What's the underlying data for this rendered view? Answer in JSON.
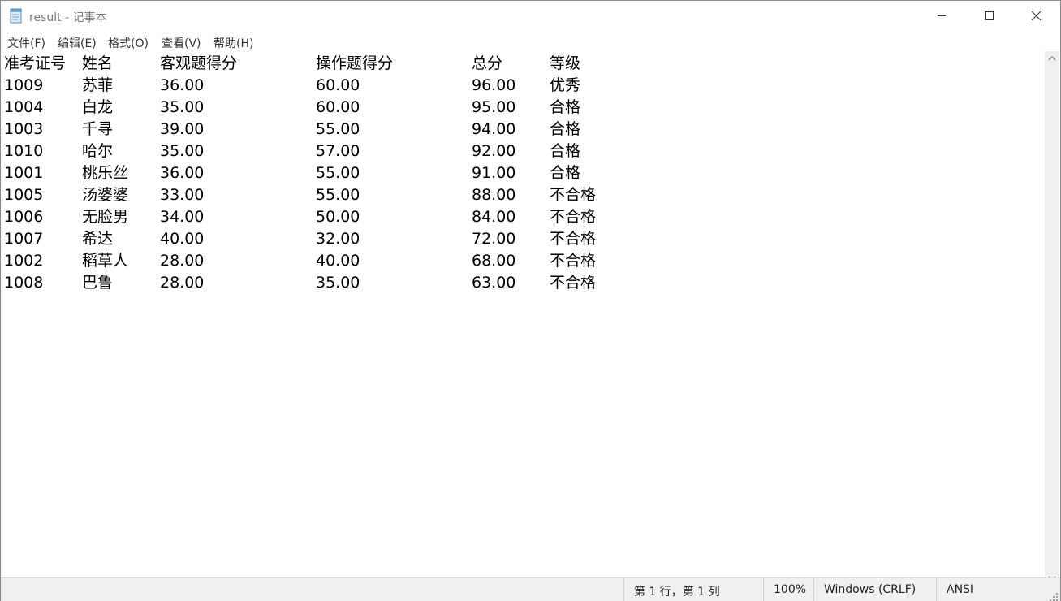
{
  "window": {
    "title": "result - 记事本",
    "icon": "notepad-icon",
    "controls": {
      "minimize_icon": "minimize-icon",
      "maximize_icon": "maximize-icon",
      "close_icon": "close-icon"
    }
  },
  "menu": [
    {
      "label": "文件(F)"
    },
    {
      "label": "编辑(E)"
    },
    {
      "label": "格式(O)"
    },
    {
      "label": "查看(V)"
    },
    {
      "label": "帮助(H)"
    }
  ],
  "document": {
    "header": [
      "准考证号",
      "姓名",
      "客观题得分",
      "操作题得分",
      "总分",
      "等级"
    ],
    "rows": [
      [
        "1009",
        "苏菲",
        "36.00",
        "60.00",
        "96.00",
        "优秀"
      ],
      [
        "1004",
        "白龙",
        "35.00",
        "60.00",
        "95.00",
        "合格"
      ],
      [
        "1003",
        "千寻",
        "39.00",
        "55.00",
        "94.00",
        "合格"
      ],
      [
        "1010",
        "哈尔",
        "35.00",
        "57.00",
        "92.00",
        "合格"
      ],
      [
        "1001",
        "桃乐丝",
        "36.00",
        "55.00",
        "91.00",
        "合格"
      ],
      [
        "1005",
        "汤婆婆",
        "33.00",
        "55.00",
        "88.00",
        "不合格"
      ],
      [
        "1006",
        "无脸男",
        "34.00",
        "50.00",
        "84.00",
        "不合格"
      ],
      [
        "1007",
        "希达",
        "40.00",
        "32.00",
        "72.00",
        "不合格"
      ],
      [
        "1002",
        "稻草人",
        "28.00",
        "40.00",
        "68.00",
        "不合格"
      ],
      [
        "1008",
        "巴鲁",
        "28.00",
        "35.00",
        "63.00",
        "不合格"
      ]
    ]
  },
  "status": {
    "position": "第 1 行，第 1 列",
    "zoom": "100%",
    "line_ending": "Windows (CRLF)",
    "encoding": "ANSI"
  },
  "colors": {
    "title_text": "#7a7a7a",
    "menu_text": "#333333",
    "status_bg": "#f0f0f0"
  }
}
